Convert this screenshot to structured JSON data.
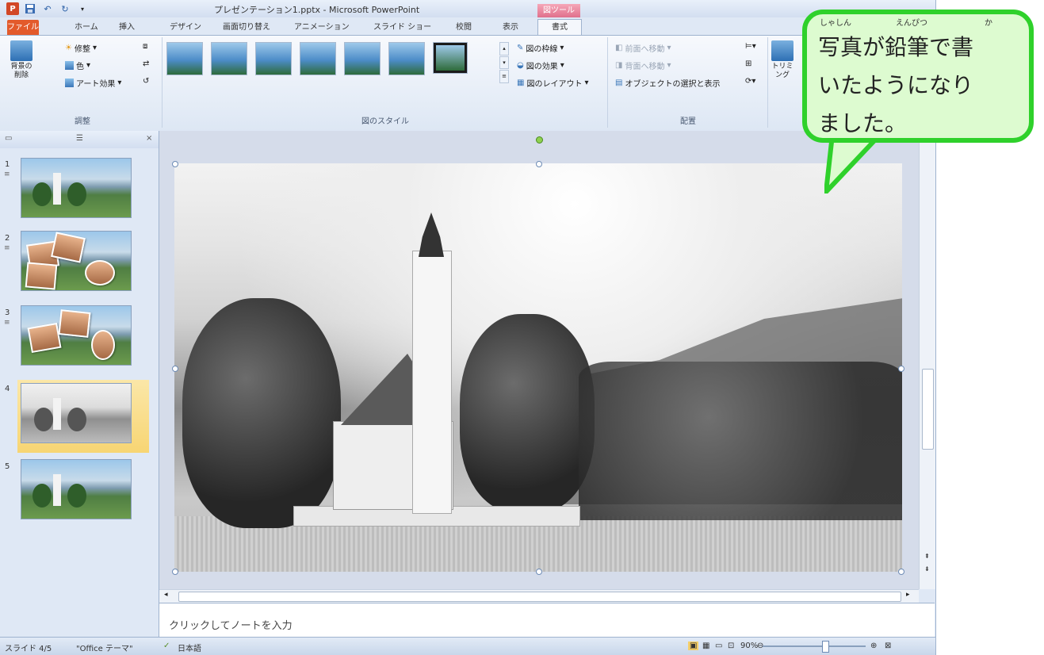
{
  "title_bar": {
    "app_icon": "P",
    "window_title": "プレゼンテーション1.pptx - Microsoft PowerPoint",
    "context_tab_group": "図ツール"
  },
  "tabs": {
    "file": "ファイル",
    "home": "ホーム",
    "insert": "挿入",
    "design": "デザイン",
    "transitions": "画面切り替え",
    "animations": "アニメーション",
    "slideshow": "スライド ショー",
    "review": "校閲",
    "view": "表示",
    "format": "書式"
  },
  "ribbon": {
    "adjust": {
      "remove_bg": "背景の削除",
      "corrections": "修整",
      "color": "色",
      "artistic": "アート効果",
      "label": "調整"
    },
    "styles": {
      "border": "図の枠線",
      "effects": "図の効果",
      "layout": "図のレイアウト",
      "label": "図のスタイル"
    },
    "arrange": {
      "bring_forward": "前面へ移動",
      "send_backward": "背面へ移動",
      "selection_pane": "オブジェクトの選択と表示",
      "label": "配置"
    },
    "size": {
      "crop": "トリミング"
    }
  },
  "left_pane": {
    "tab_outline": "",
    "close": "×",
    "slides": [
      {
        "number": "1",
        "type": "landscape"
      },
      {
        "number": "2",
        "type": "photos"
      },
      {
        "number": "3",
        "type": "photos"
      },
      {
        "number": "4",
        "type": "sketch",
        "selected": true
      },
      {
        "number": "5",
        "type": "landscape"
      }
    ]
  },
  "notes": {
    "placeholder": "クリックしてノートを入力"
  },
  "status_bar": {
    "slide_info": "スライド 4/5",
    "theme": "\"Office テーマ\"",
    "language": "日本語",
    "zoom": "90%"
  },
  "callout": {
    "line1": "写真が鉛筆で書",
    "line2": "いたようになり",
    "line3": "ました。",
    "ruby1": "しゃしん",
    "ruby2": "えんぴつ",
    "ruby3": "か",
    "border_color": "#2fd12b",
    "fill_color": "#ddfbd0"
  }
}
